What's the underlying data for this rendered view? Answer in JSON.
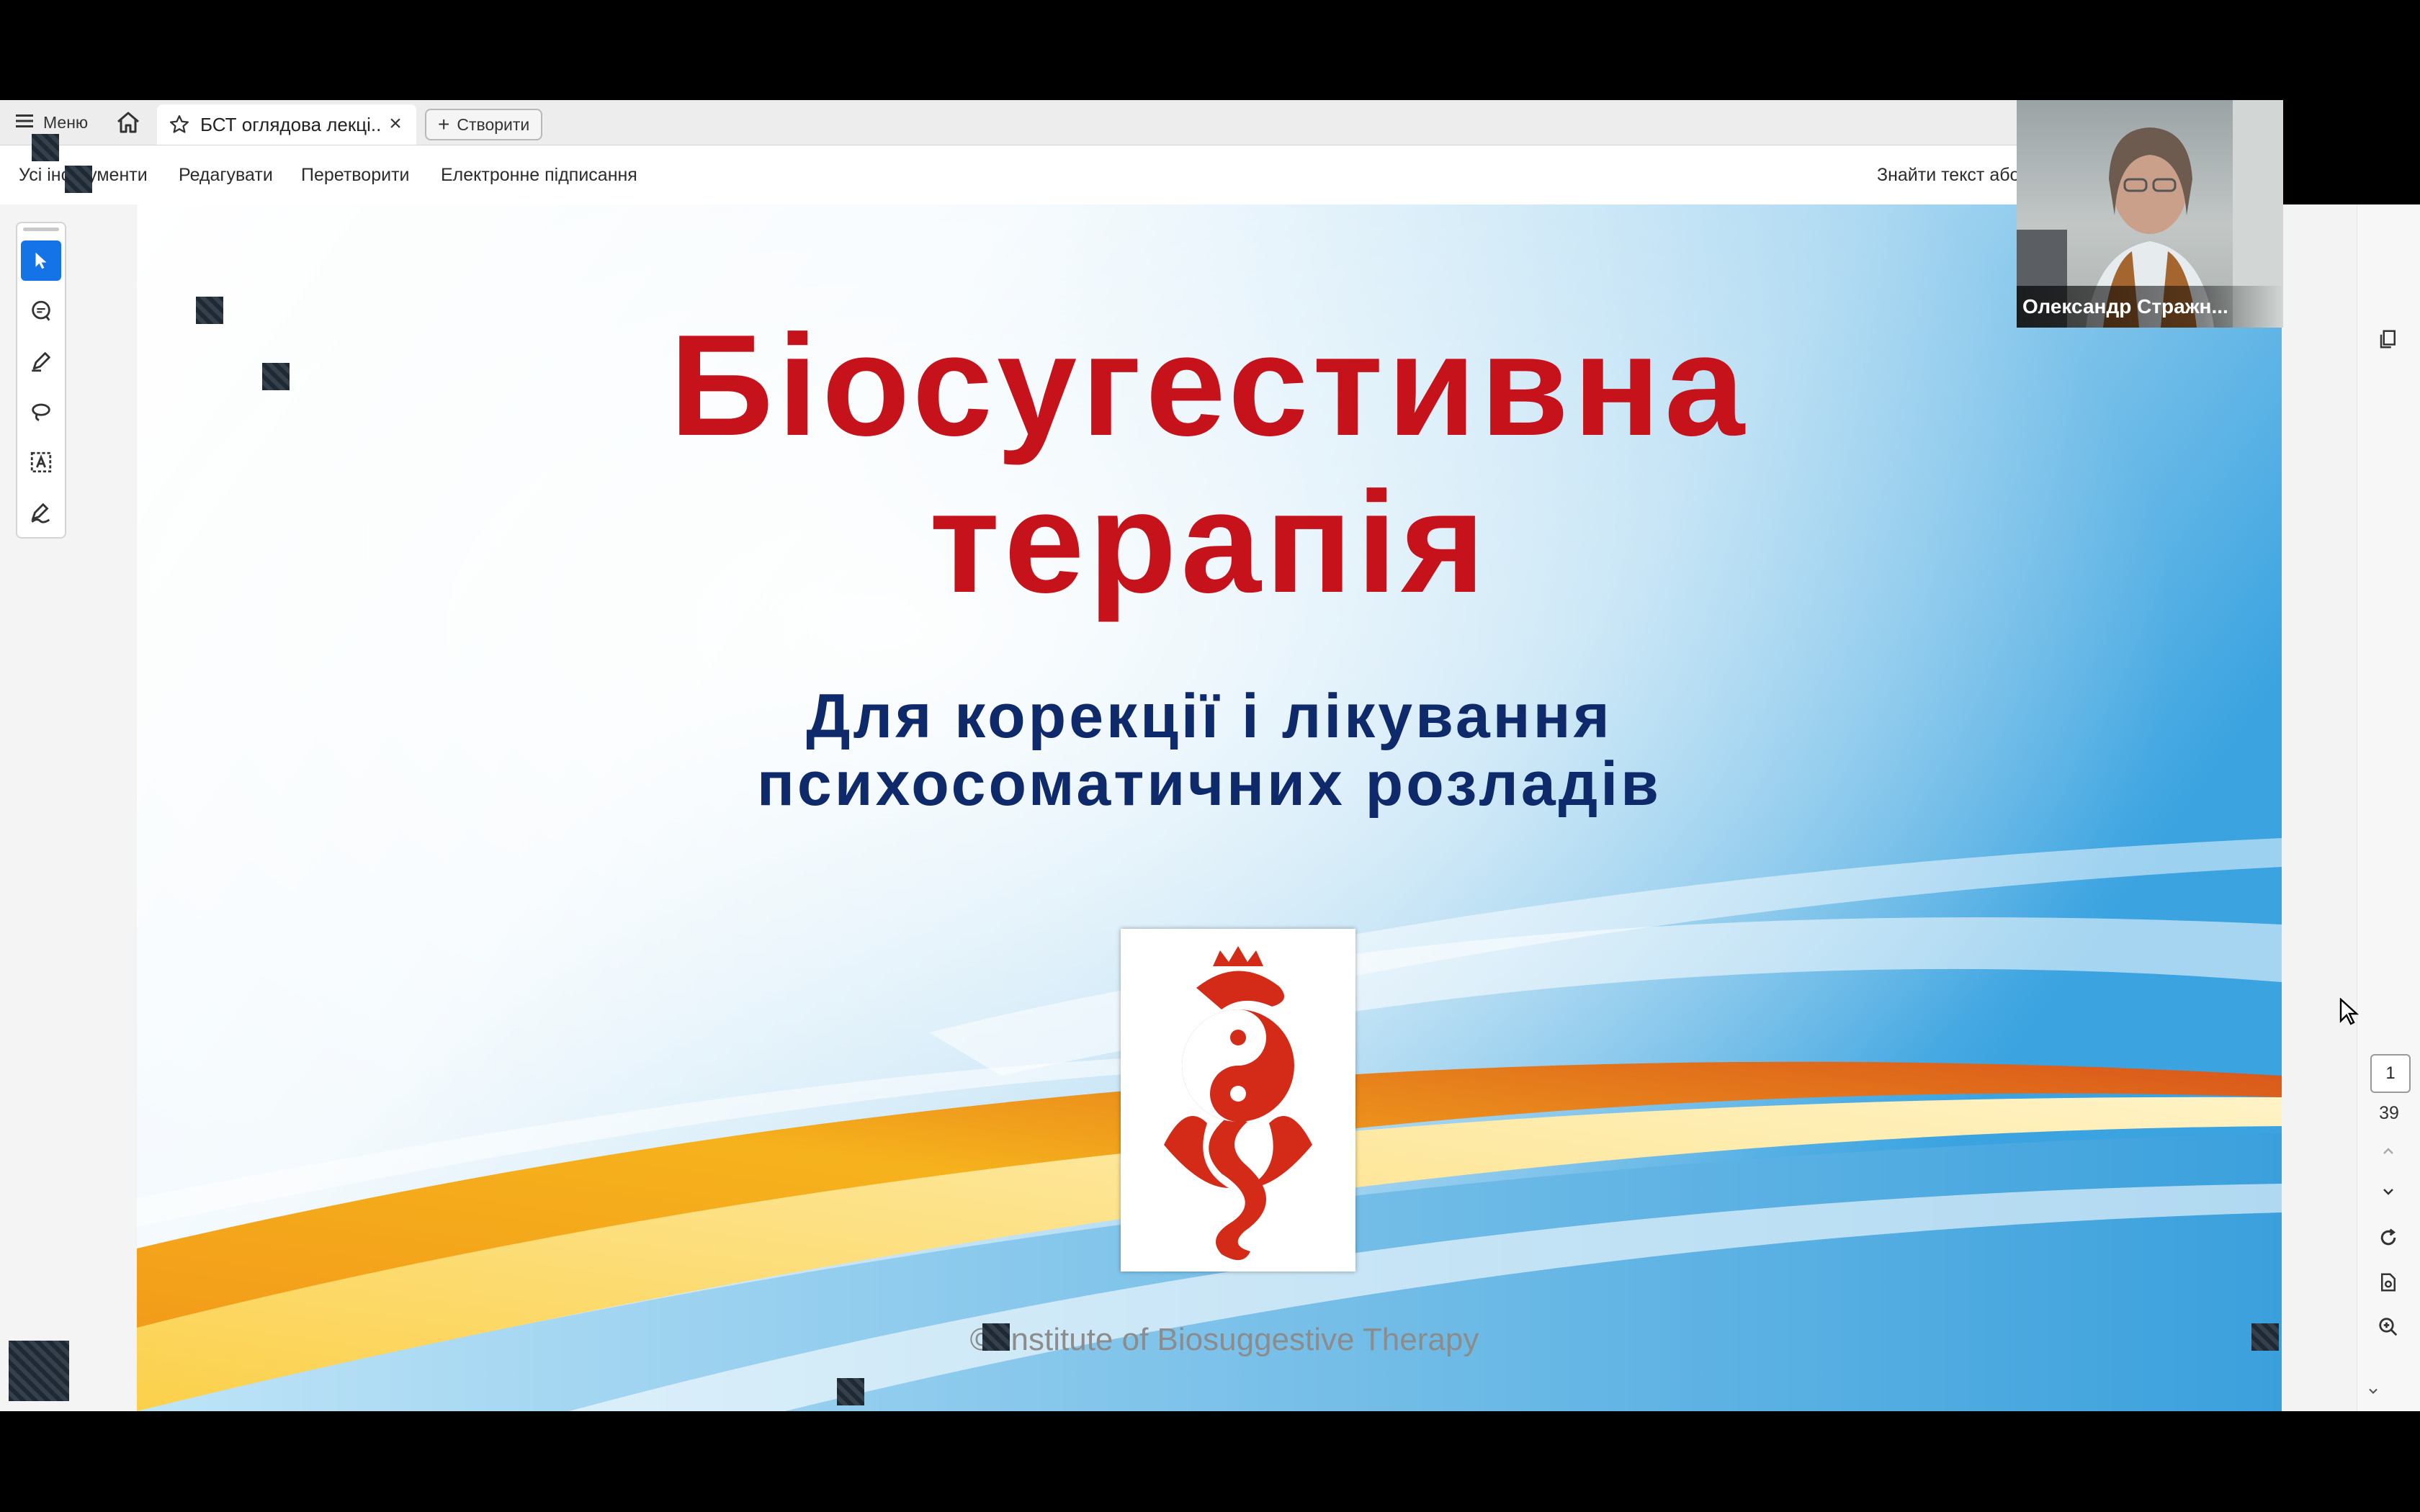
{
  "tabbar": {
    "menu_label": "Меню",
    "tab_title": "БСТ оглядова лекці...",
    "create_label": "Створити"
  },
  "toolbar": {
    "all_tools": "Усі інструменти",
    "edit": "Редагувати",
    "convert": "Перетворити",
    "e_sign": "Електронне підписання",
    "find_text": "Знайти текст або"
  },
  "slide": {
    "title_line1": "Біосугестивна",
    "title_line2": "терапія",
    "subtitle_line1": "Для корекції і лікування",
    "subtitle_line2": "психосоматичних розладів",
    "copyright": "© Institute of Biosuggestive Therapy",
    "colors": {
      "title": "#c6121a",
      "subtitle": "#0e2a6b",
      "logo": "#d42a18"
    }
  },
  "page_nav": {
    "current_page": "1",
    "total_pages": "39"
  },
  "video": {
    "participant_name": "Олександр Стражн..."
  },
  "icons": {
    "menu": "hamburger-icon",
    "home": "home-icon",
    "star": "star-icon",
    "close": "close-icon",
    "plus": "plus-icon",
    "select": "arrow-cursor-icon",
    "comment": "comment-icon",
    "highlight": "pen-icon",
    "draw": "lasso-icon",
    "text": "text-box-icon",
    "sign": "signature-icon"
  }
}
